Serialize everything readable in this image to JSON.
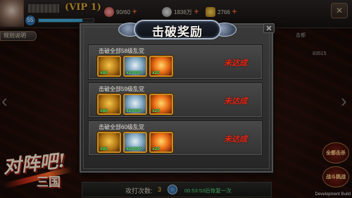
{
  "header": {
    "vip_label": "(VIP 1)",
    "level": "55",
    "exp_fraction": 0.8,
    "stamina": "90/60",
    "stamina_plus": "+",
    "silver": "1836万",
    "silver_plus": "+",
    "gold": "2766",
    "gold_plus": "+"
  },
  "rules_button": "规则说明",
  "score_label": "击都",
  "score_value": "83515",
  "modal": {
    "title": "击破奖励",
    "rows": [
      {
        "title": "击破全部58级乱党",
        "status": "未达成",
        "items": [
          {
            "icon": "gold-horse-icon",
            "qty": "x80"
          },
          {
            "icon": "silver-ore-icon",
            "qty": "x20000"
          },
          {
            "icon": "fire-scroll-icon",
            "qty": "x20"
          }
        ]
      },
      {
        "title": "击破全部59级乱党",
        "status": "未达成",
        "items": [
          {
            "icon": "gold-horse-icon",
            "qty": "x80"
          },
          {
            "icon": "silver-ore-icon",
            "qty": "x20000"
          },
          {
            "icon": "fire-scroll-icon",
            "qty": "x20"
          }
        ]
      },
      {
        "title": "击破全部60级乱党",
        "status": "未达成",
        "items": [
          {
            "icon": "gold-horse-icon",
            "qty": "x80"
          },
          {
            "icon": "silver-ore-icon",
            "qty": "x20000"
          },
          {
            "icon": "fire-scroll-icon",
            "qty": "x20"
          }
        ]
      }
    ]
  },
  "footer": {
    "attack_label": "攻打次数:",
    "attack_count": "3",
    "timer": "00:53:53后恢复一次",
    "dev_build": "Development Build"
  },
  "logo": {
    "main": "对阵吧!",
    "sub": "三国"
  },
  "side_buttons": [
    "全都击杀",
    "战斗挑战"
  ]
}
